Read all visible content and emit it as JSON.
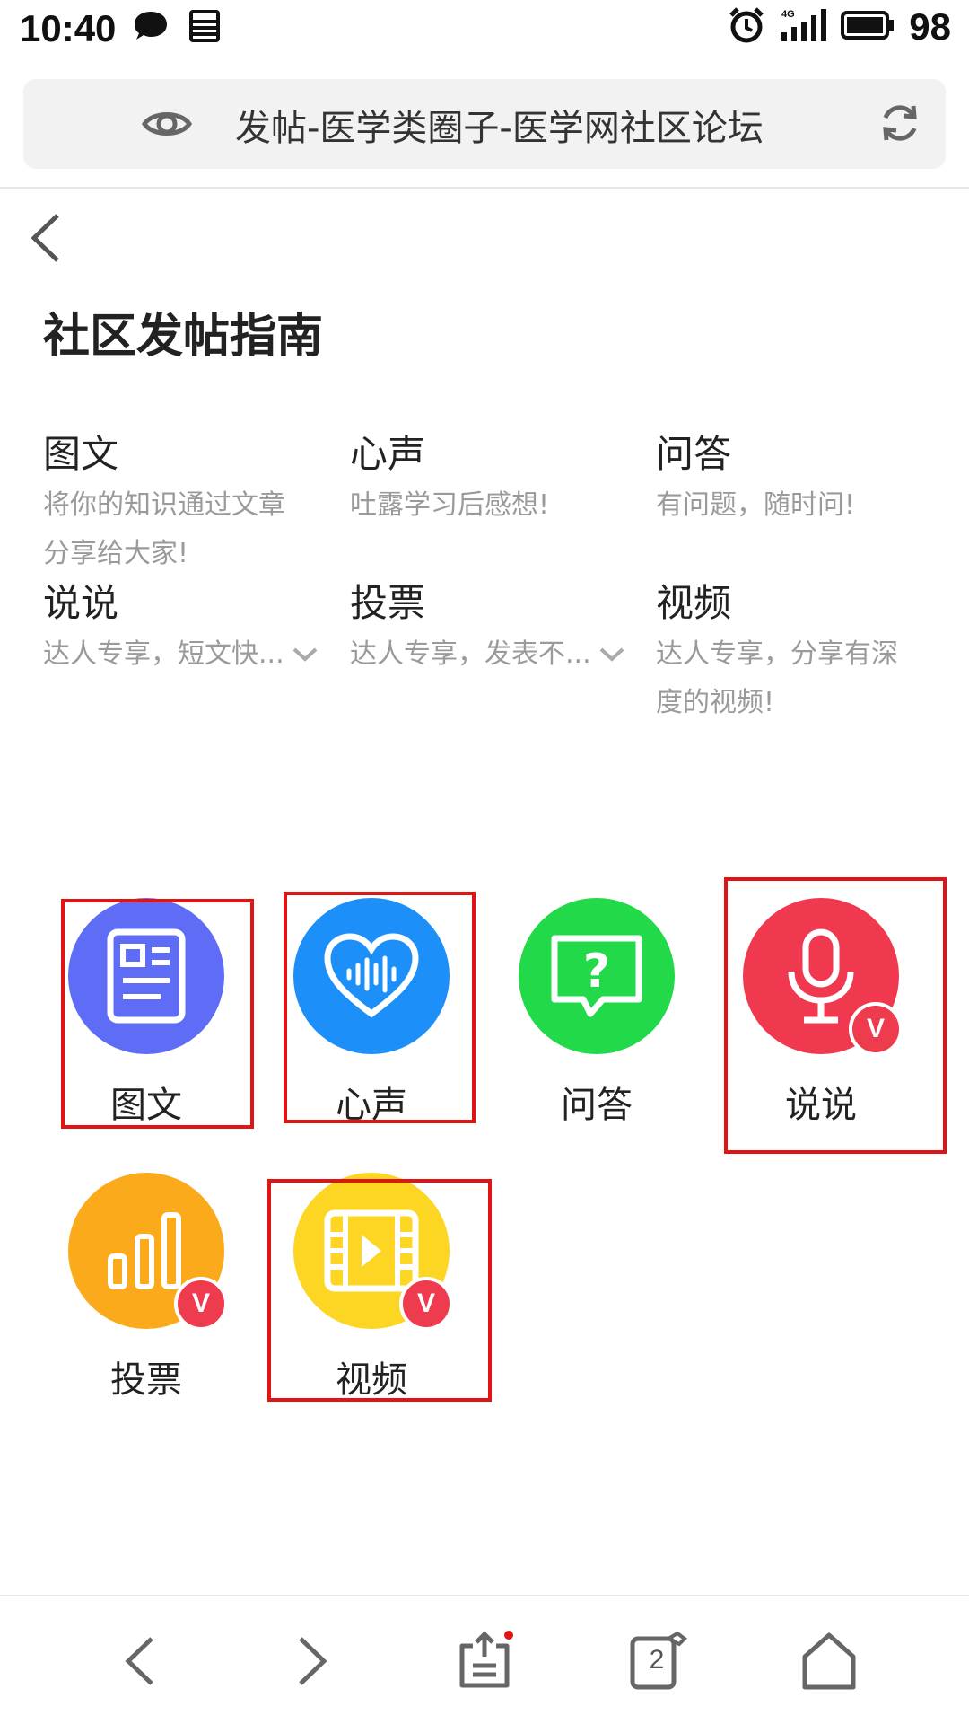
{
  "status_bar": {
    "time": "10:40",
    "battery": "98",
    "network": "4G"
  },
  "address_bar": {
    "title": "发帖-医学类圈子-医学网社区论坛"
  },
  "page": {
    "title": "社区发帖指南"
  },
  "guide": [
    {
      "title": "图文",
      "desc": "将你的知识通过文章分享给大家!"
    },
    {
      "title": "心声",
      "desc": "吐露学习后感想!"
    },
    {
      "title": "问答",
      "desc": "有问题，随时问!"
    },
    {
      "title": "说说",
      "desc": "达人专享，短文快..."
    },
    {
      "title": "投票",
      "desc": "达人专享，发表不..."
    },
    {
      "title": "视频",
      "desc": "达人专享，分享有深度的视频!"
    }
  ],
  "post_types": [
    {
      "label": "图文",
      "color": "#5f6cf6",
      "icon": "article-icon"
    },
    {
      "label": "心声",
      "color": "#1c8ff8",
      "icon": "heart-voice-icon"
    },
    {
      "label": "问答",
      "color": "#22d94a",
      "icon": "question-bubble-icon"
    },
    {
      "label": "说说",
      "color": "#f0384f",
      "icon": "microphone-icon",
      "badge": "V"
    },
    {
      "label": "投票",
      "color": "#fbaa1c",
      "icon": "bar-chart-icon",
      "badge": "V"
    },
    {
      "label": "视频",
      "color": "#fcd622",
      "icon": "video-film-icon",
      "badge": "V"
    }
  ],
  "bottom_nav": {
    "tabs_count": "2"
  },
  "colors": {
    "highlight_box": "#e11414",
    "vip_badge": "#ee3b4d"
  }
}
